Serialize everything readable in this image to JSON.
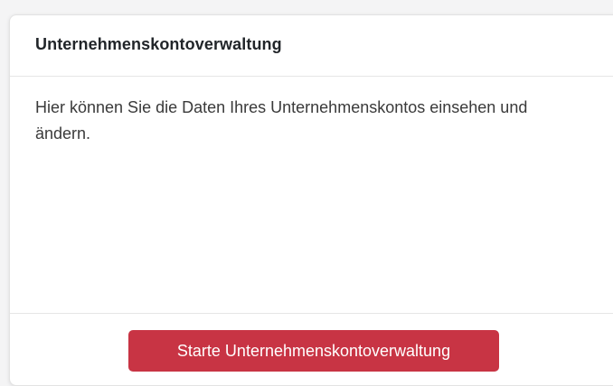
{
  "card": {
    "title": "Unternehmenskontoverwaltung",
    "description": "Hier können Sie die Daten Ihres Unternehmenskontos einsehen und ändern.",
    "button_label": "Starte Unternehmenskontoverwaltung"
  },
  "colors": {
    "button_background": "#c83444",
    "button_text": "#ffffff",
    "card_background": "#ffffff",
    "page_background": "#f4f4f5"
  }
}
